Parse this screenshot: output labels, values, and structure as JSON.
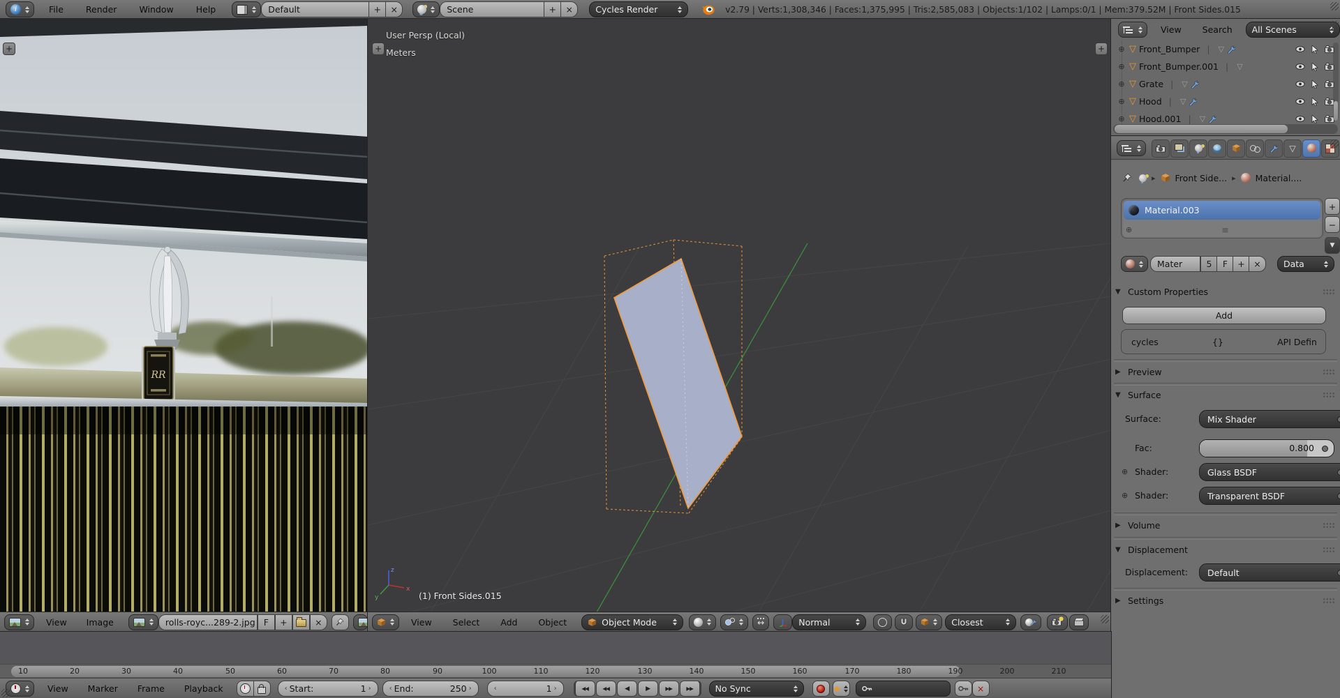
{
  "icons": {
    "plus": "+",
    "minus": "−",
    "close": "×",
    "collapse": "▼",
    "expand": "▶",
    "crumb_sep": "▸",
    "pipe": "|",
    "mesh_tri": "▽",
    "slot_add": "⊕",
    "grip": "≡",
    "diamond": "◆",
    "info": "i",
    "manip_arrows": "↔",
    "ts_jump_start": "◀◀",
    "ts_prev_key": "◀◀",
    "ts_play_rev": "◀",
    "ts_play": "▶",
    "ts_next_key": "▶▶",
    "ts_jump_end": "▶▶"
  },
  "topbar": {
    "menus": {
      "file": "File",
      "render": "Render",
      "window": "Window",
      "help": "Help"
    },
    "layout_name": "Default",
    "scene_name": "Scene",
    "render_engine": "Cycles Render",
    "stats": "v2.79 | Verts:1,308,346 | Faces:1,375,995 | Tris:2,585,083 | Objects:1/102 | Lamps:0/1 | Mem:379.52M | Front Sides.015"
  },
  "image_editor": {
    "menus": {
      "view": "View",
      "image": "Image"
    },
    "image_name": "rolls-royc...289-2.jpg",
    "fake_user_label": "F",
    "badge_text": "RR"
  },
  "viewport": {
    "overlay_view": "User Persp (Local)",
    "overlay_units": "Meters",
    "object_label": "(1) Front Sides.015",
    "menus": {
      "view": "View",
      "select": "Select",
      "add": "Add",
      "object": "Object"
    },
    "mode": "Object Mode",
    "orientation": "Normal",
    "snap_target": "Closest",
    "axes": {
      "x": "x",
      "y": "y",
      "z": "z"
    }
  },
  "outliner": {
    "menus": {
      "view": "View",
      "search": "Search"
    },
    "scope": "All Scenes",
    "items": [
      {
        "label": "Front_Bumper"
      },
      {
        "label": "Front_Bumper.001"
      },
      {
        "label": "Grate"
      },
      {
        "label": "Hood"
      },
      {
        "label": "Hood.001"
      }
    ]
  },
  "properties": {
    "breadcrumb": {
      "object": "Front Side...",
      "material": "Material...."
    },
    "material_slot": "Material.003",
    "datablock": {
      "name": "Mater",
      "users": "5",
      "fake": "F"
    },
    "link_mode": "Data",
    "custom_properties": {
      "title": "Custom Properties",
      "add_label": "Add",
      "prop_name": "cycles",
      "prop_value": "{}",
      "prop_edit_label": "API Defin"
    },
    "preview_title": "Preview",
    "surface": {
      "title": "Surface",
      "surface_label": "Surface:",
      "surface_value": "Mix Shader",
      "fac_label": "Fac:",
      "fac_value": "0.800",
      "shader_label": "Shader:",
      "shader1_value": "Glass BSDF",
      "shader2_value": "Transparent BSDF"
    },
    "volume_title": "Volume",
    "displacement": {
      "title": "Displacement",
      "label": "Displacement:",
      "value": "Default"
    },
    "settings_title": "Settings"
  },
  "timeline": {
    "menus": {
      "view": "View",
      "marker": "Marker",
      "frame": "Frame",
      "playback": "Playback"
    },
    "start_label": "Start:",
    "start_value": "1",
    "end_label": "End:",
    "end_value": "250",
    "current_frame": "1",
    "sync_mode": "No Sync",
    "ruler_ticks": [
      "10",
      "20",
      "30",
      "40",
      "50",
      "60",
      "70",
      "80",
      "90",
      "100",
      "110",
      "120",
      "130",
      "140",
      "150",
      "160",
      "170",
      "180",
      "190",
      "200",
      "210"
    ]
  },
  "colors": {
    "accent_selection": "#5680c2",
    "accent_orange": "#e8962d",
    "record_red": "#b21f10",
    "axis_green": "#3e8a3e",
    "viewport_bg": "#3c3c3e"
  }
}
